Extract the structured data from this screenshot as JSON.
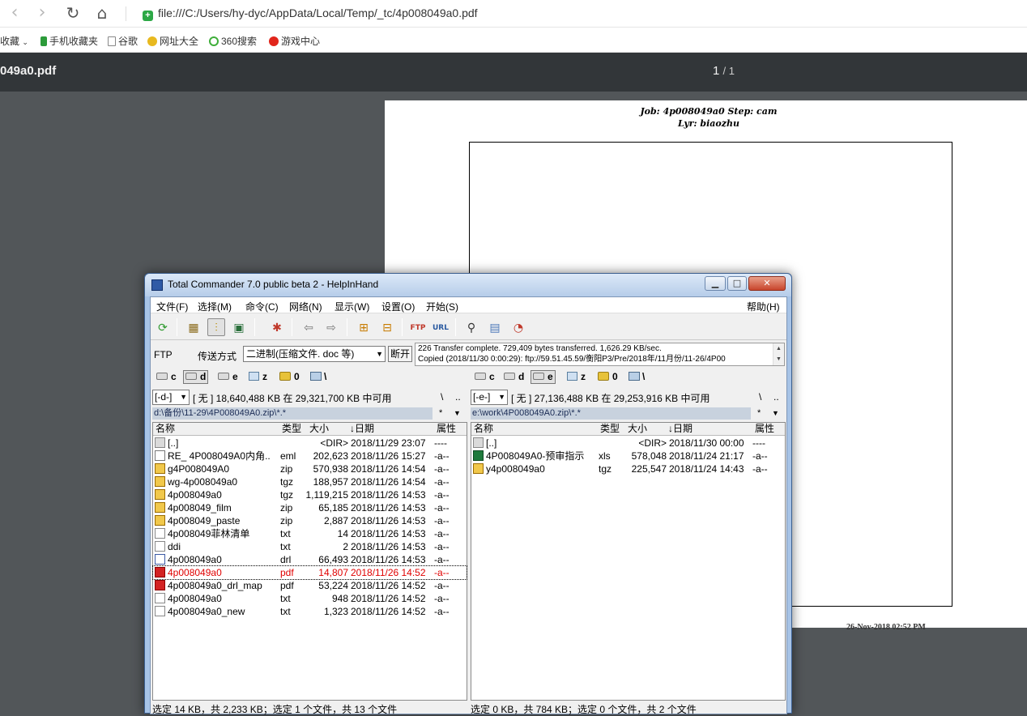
{
  "browser": {
    "url": "file:///C:/Users/hy-dyc/AppData/Local/Temp/_tc/4p008049a0.pdf",
    "bookmarks": [
      "收藏",
      "手机收藏夹",
      "谷歌",
      "网址大全",
      "360搜索",
      "游戏中心"
    ]
  },
  "pdf": {
    "file_name": "049a0.pdf",
    "page_current": "1",
    "page_total": "/ 1",
    "page_title_line1": "Job: 4p008049a0  Step: cam",
    "page_title_line2": "Lyr: biaozhu",
    "page_footer": "26-Nov-2018 02:52 PM"
  },
  "tc": {
    "title": "Total Commander 7.0 public beta 2 - HelpInHand",
    "menu": [
      "文件(F)",
      "选择(M)",
      "命令(C)",
      "网络(N)",
      "显示(W)",
      "设置(O)",
      "开始(S)"
    ],
    "help_menu": "帮助(H)",
    "ftp": {
      "label": "FTP",
      "mode_label": "传送方式",
      "mode_value": "二进制(压缩文件. doc 等)",
      "disconnect": "断开",
      "log_line1": "226 Transfer complete. 729,409 bytes transferred. 1,626.29 KB/sec.",
      "log_line2": "Copied (2018/11/30 0:00:29): ftp://59.51.45.59/衡阳P3/Pre/2018年/11月份/11-26/4P00"
    },
    "drives": [
      "c",
      "d",
      "e",
      "z",
      "0",
      "\\"
    ],
    "left": {
      "drive_select": "[-d-]",
      "info": "[ 无 ]  18,640,488 KB 在 29,321,700 KB 中可用",
      "path": "d:\\备份\\11-29\\4P008049A0.zip\\*.*",
      "filter": "*",
      "columns": [
        "名称",
        "类型",
        "大小",
        "↓日期",
        "属性"
      ],
      "files": [
        {
          "name": "[..]",
          "ext": "",
          "size": "<DIR>",
          "date": "2018/11/29 23:07",
          "attr": "----",
          "icon": "up"
        },
        {
          "name": "RE_ 4P008049A0内角..",
          "ext": "eml",
          "size": "202,623",
          "date": "2018/11/26 15:27",
          "attr": "-a--",
          "icon": "eml"
        },
        {
          "name": "g4P008049A0",
          "ext": "zip",
          "size": "570,938",
          "date": "2018/11/26 14:54",
          "attr": "-a--",
          "icon": "zip"
        },
        {
          "name": "wg-4p008049a0",
          "ext": "tgz",
          "size": "188,957",
          "date": "2018/11/26 14:54",
          "attr": "-a--",
          "icon": "zip"
        },
        {
          "name": "4p008049a0",
          "ext": "tgz",
          "size": "1,119,215",
          "date": "2018/11/26 14:53",
          "attr": "-a--",
          "icon": "zip"
        },
        {
          "name": "4p008049_film",
          "ext": "zip",
          "size": "65,185",
          "date": "2018/11/26 14:53",
          "attr": "-a--",
          "icon": "zip"
        },
        {
          "name": "4p008049_paste",
          "ext": "zip",
          "size": "2,887",
          "date": "2018/11/26 14:53",
          "attr": "-a--",
          "icon": "zip"
        },
        {
          "name": "4p008049菲林清单",
          "ext": "txt",
          "size": "14",
          "date": "2018/11/26 14:53",
          "attr": "-a--",
          "icon": "txt"
        },
        {
          "name": "ddi",
          "ext": "txt",
          "size": "2",
          "date": "2018/11/26 14:53",
          "attr": "-a--",
          "icon": "txt"
        },
        {
          "name": "4p008049a0",
          "ext": "drl",
          "size": "66,493",
          "date": "2018/11/26 14:53",
          "attr": "-a--",
          "icon": "drl"
        },
        {
          "name": "4p008049a0",
          "ext": "pdf",
          "size": "14,807",
          "date": "2018/11/26 14:52",
          "attr": "-a--",
          "icon": "pdf",
          "current": true
        },
        {
          "name": "4p008049a0_drl_map",
          "ext": "pdf",
          "size": "53,224",
          "date": "2018/11/26 14:52",
          "attr": "-a--",
          "icon": "pdf"
        },
        {
          "name": "4p008049a0",
          "ext": "txt",
          "size": "948",
          "date": "2018/11/26 14:52",
          "attr": "-a--",
          "icon": "txt"
        },
        {
          "name": "4p008049a0_new",
          "ext": "txt",
          "size": "1,323",
          "date": "2018/11/26 14:52",
          "attr": "-a--",
          "icon": "txt"
        }
      ],
      "status": "选定 14 KB，共 2,233 KB；选定 1 个文件，共 13 个文件"
    },
    "right": {
      "drive_select": "[-e-]",
      "info": "[ 无 ]  27,136,488 KB 在 29,253,916 KB 中可用",
      "path": "e:\\work\\4P008049A0.zip\\*.*",
      "filter": "*",
      "columns": [
        "名称",
        "类型",
        "大小",
        "↓日期",
        "属性"
      ],
      "files": [
        {
          "name": "[..]",
          "ext": "",
          "size": "<DIR>",
          "date": "2018/11/30 00:00",
          "attr": "----",
          "icon": "up"
        },
        {
          "name": "4P008049A0-预审指示",
          "ext": "xls",
          "size": "578,048",
          "date": "2018/11/24 21:17",
          "attr": "-a--",
          "icon": "xls"
        },
        {
          "name": "y4p008049a0",
          "ext": "tgz",
          "size": "225,547",
          "date": "2018/11/24 14:43",
          "attr": "-a--",
          "icon": "zip"
        }
      ],
      "status": "选定 0 KB，共 784 KB；选定 0 个文件，共 2 个文件"
    }
  }
}
